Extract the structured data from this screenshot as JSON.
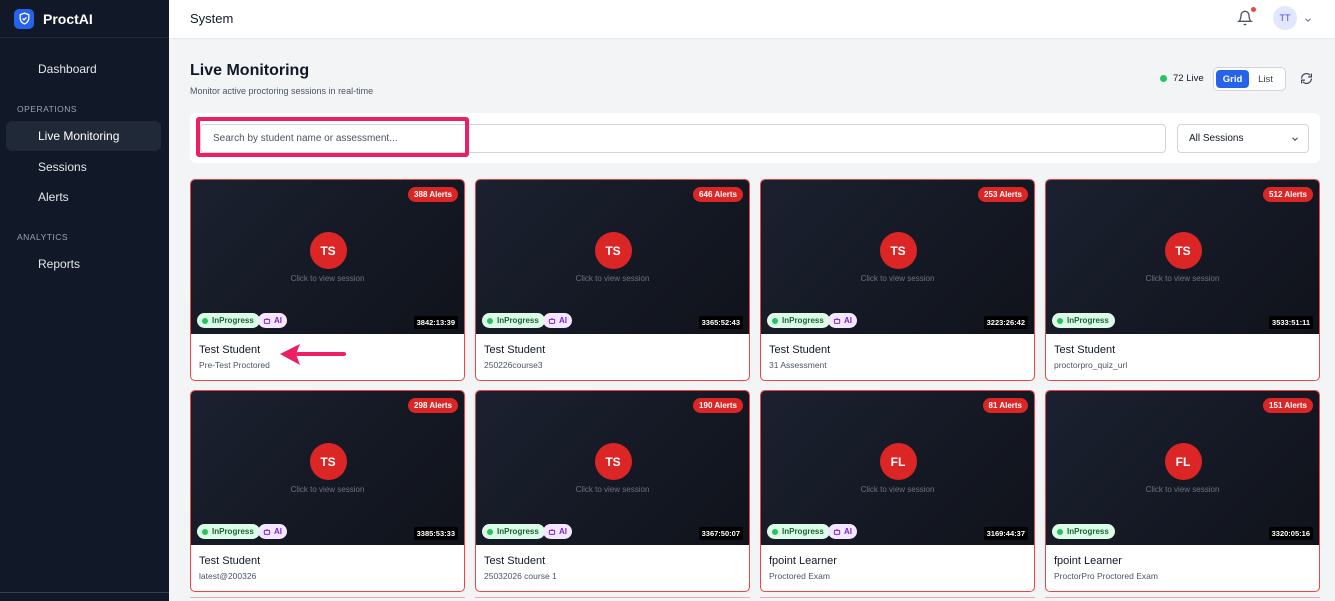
{
  "brand": {
    "name": "ProctAI",
    "logo_icon": "shield-icon",
    "accent": "#2563eb"
  },
  "sidebar": {
    "items": [
      {
        "label": "Dashboard"
      },
      {
        "label": "Live Monitoring",
        "active": true
      },
      {
        "label": "Sessions"
      },
      {
        "label": "Alerts"
      },
      {
        "label": "Reports"
      }
    ],
    "sections": {
      "operations": "OPERATIONS",
      "analytics": "ANALYTICS"
    }
  },
  "topbar": {
    "title": "System",
    "user_initials": "TT",
    "has_notification": true
  },
  "header": {
    "title": "Live Monitoring",
    "subtitle": "Monitor active proctoring sessions in real-time",
    "live_count": "72 Live",
    "view_grid": "Grid",
    "view_list": "List",
    "active_view": "Grid"
  },
  "search": {
    "placeholder": "Search by student name or assessment...",
    "value": ""
  },
  "filter": {
    "selected": "All Sessions"
  },
  "colors": {
    "alert_red": "#dc2626",
    "live_green": "#22c55e",
    "highlight": "#ec1f62"
  },
  "sessions": [
    {
      "alerts": "388 Alerts",
      "initials": "TS",
      "hint": "Click to view session",
      "status": "InProgress",
      "ai": "AI",
      "timer": "3842:13:39",
      "student": "Test Student",
      "assessment": "Pre-Test Proctored"
    },
    {
      "alerts": "646 Alerts",
      "initials": "TS",
      "hint": "Click to view session",
      "status": "InProgress",
      "ai": "AI",
      "timer": "3365:52:43",
      "student": "Test Student",
      "assessment": "250226course3"
    },
    {
      "alerts": "253 Alerts",
      "initials": "TS",
      "hint": "Click to view session",
      "status": "InProgress",
      "ai": "AI",
      "timer": "3223:26:42",
      "student": "Test Student",
      "assessment": "31 Assessment"
    },
    {
      "alerts": "512 Alerts",
      "initials": "TS",
      "hint": "Click to view session",
      "status": "InProgress",
      "ai": "",
      "timer": "3533:51:11",
      "student": "Test Student",
      "assessment": "proctorpro_quiz_url"
    },
    {
      "alerts": "298 Alerts",
      "initials": "TS",
      "hint": "Click to view session",
      "status": "InProgress",
      "ai": "AI",
      "timer": "3385:53:33",
      "student": "Test Student",
      "assessment": "latest@200326"
    },
    {
      "alerts": "190 Alerts",
      "initials": "TS",
      "hint": "Click to view session",
      "status": "InProgress",
      "ai": "AI",
      "timer": "3367:50:07",
      "student": "Test Student",
      "assessment": "25032026 course 1"
    },
    {
      "alerts": "81 Alerts",
      "initials": "FL",
      "hint": "Click to view session",
      "status": "InProgress",
      "ai": "AI",
      "timer": "3169:44:37",
      "student": "fpoint Learner",
      "assessment": "Proctored Exam"
    },
    {
      "alerts": "151 Alerts",
      "initials": "FL",
      "hint": "Click to view session",
      "status": "InProgress",
      "ai": "",
      "timer": "3320:05:16",
      "student": "fpoint Learner",
      "assessment": "ProctorPro Proctored Exam"
    }
  ]
}
